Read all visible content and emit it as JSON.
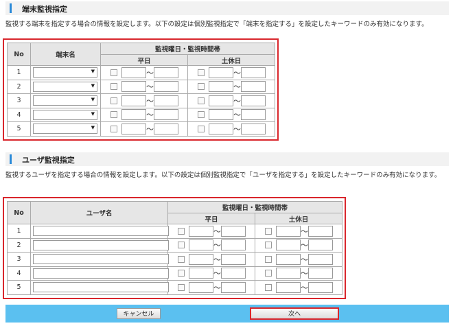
{
  "section1": {
    "title": "端末監視指定",
    "description": "監視する端末を指定する場合の情報を設定します。以下の設定は個別監視指定で「端末を指定する」を設定したキーワードのみ有効になります。",
    "headers": {
      "no": "No",
      "name": "端末名",
      "schedule": "監視曜日・監視時間帯",
      "weekday": "平日",
      "holiday": "土休日"
    },
    "rows": [
      "1",
      "2",
      "3",
      "4",
      "5"
    ]
  },
  "section2": {
    "title": "ユーザ監視指定",
    "description": "監視するユーザを指定する場合の情報を設定します。以下の設定は個別監視指定で「ユーザを指定する」を設定したキーワードのみ有効になります。",
    "headers": {
      "no": "No",
      "name": "ユーザ名",
      "schedule": "監視曜日・監視時間帯",
      "weekday": "平日",
      "holiday": "土休日"
    },
    "rows": [
      "1",
      "2",
      "3",
      "4",
      "5"
    ]
  },
  "common": {
    "tilde": "～",
    "dropdown_arrow": "▼"
  },
  "footer": {
    "cancel_label": "キャンセル",
    "next_label": "次へ"
  },
  "colors": {
    "accent": "#2a8ad8",
    "highlight": "#d9262c",
    "footer_bg": "#5bc0f0"
  }
}
